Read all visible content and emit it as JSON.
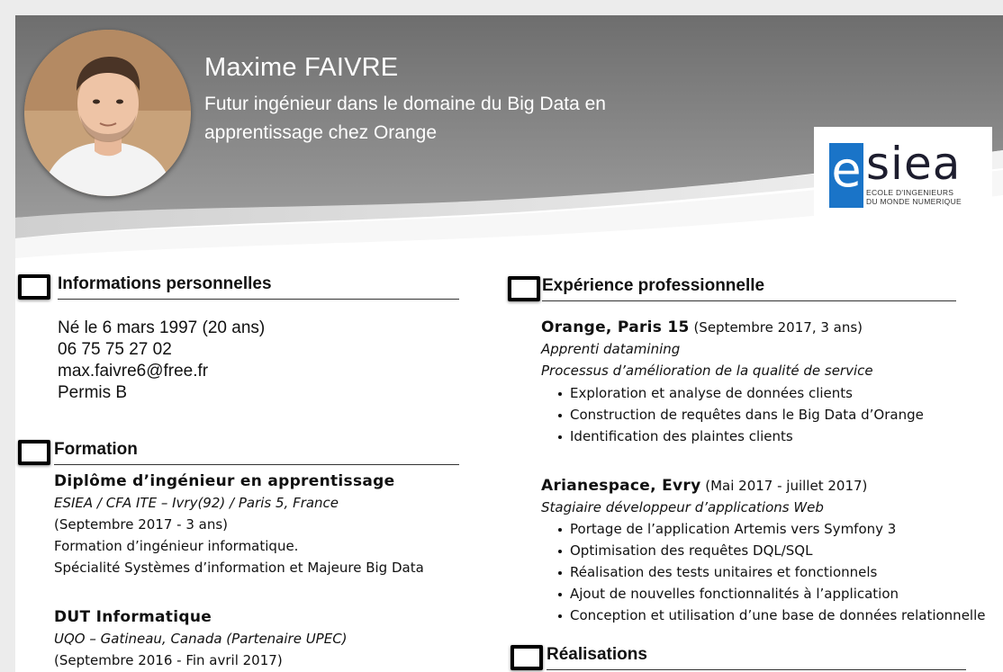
{
  "header": {
    "name": "Maxime FAIVRE",
    "tagline": "Futur ingénieur dans le domaine du Big Data en apprentissage chez Orange"
  },
  "logo": {
    "letter_e": "e",
    "letters": "siea",
    "subtitle_line1": "ECOLE D'INGENIEURS",
    "subtitle_line2": "DU MONDE NUMERIQUE",
    "brand_color": "#1a74c8"
  },
  "personal": {
    "heading": "Informations personnelles",
    "lines": [
      "Né le 6 mars 1997 (20 ans)",
      "06 75 75 27 02",
      "max.faivre6@free.fr",
      "Permis B"
    ]
  },
  "formation": {
    "heading": "Formation",
    "entries": [
      {
        "title": "Diplôme d’ingénieur en apprentissage",
        "school": "ESIEA / CFA ITE – Ivry(92) / Paris 5, France",
        "period": "(Septembre 2017 -  3 ans)",
        "details": [
          "Formation d’ingénieur informatique.",
          "Spécialité Systèmes d’information et Majeure Big Data"
        ]
      },
      {
        "title": "DUT Informatique",
        "school": "UQO – Gatineau, Canada (Partenaire UPEC)",
        "period": "(Septembre 2016 -  Fin avril 2017)"
      }
    ]
  },
  "experience": {
    "heading": "Expérience professionnelle",
    "jobs": [
      {
        "company": "Orange, Paris 15",
        "period": " (Septembre 2017, 3 ans)",
        "role": "Apprenti datamining",
        "subtitle": "Processus d’amélioration de la qualité de service",
        "tasks": [
          "Exploration et analyse de données clients",
          "Construction de requêtes dans le Big Data d’Orange",
          "Identification des plaintes clients"
        ]
      },
      {
        "company": "Arianespace, Evry",
        "period": " (Mai 2017 - juillet 2017)",
        "role": "Stagiaire développeur d’applications Web",
        "tasks": [
          "Portage de l’application Artemis vers Symfony 3",
          "Optimisation des requêtes DQL/SQL",
          "Réalisation des tests unitaires et fonctionnels",
          "Ajout de nouvelles fonctionnalités à l’application",
          "Conception et utilisation d’une base de données relationnelle"
        ]
      }
    ]
  },
  "realisations": {
    "heading": "Réalisations"
  }
}
